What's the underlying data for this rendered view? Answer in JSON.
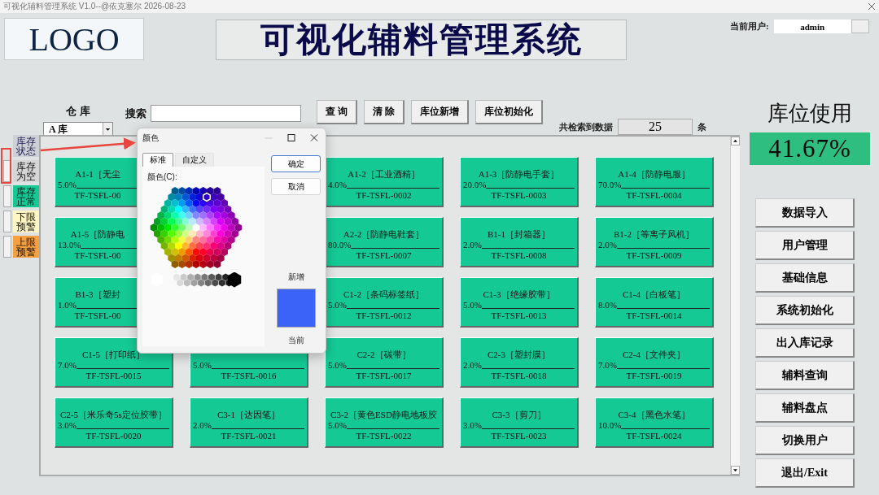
{
  "window": {
    "title": "可视化辅料管理系统 V1.0--@依克塞尔  2026-08-23"
  },
  "logo": "LOGO",
  "app_title": "可视化辅料管理系统",
  "user": {
    "label": "当前用户:",
    "value": "admin"
  },
  "warehouse": {
    "label": "仓 库",
    "value": "A 库"
  },
  "search": {
    "label": "搜索"
  },
  "actions": [
    "查 询",
    "清 除",
    "库位新增",
    "库位初始化"
  ],
  "result": {
    "label": "共检索到数据",
    "count": "25",
    "unit": "条"
  },
  "usage": {
    "label": "库位使用",
    "value": "41.67%"
  },
  "legend": [
    {
      "kind": "header",
      "label": "库存状态"
    },
    {
      "kind": "swatch",
      "label": "库存为空",
      "color": "#d6d6d6"
    },
    {
      "kind": "swatch",
      "label": "库存正常",
      "color": "#14c994"
    },
    {
      "kind": "swatch",
      "label": "下限预警",
      "color": "#fff6c2"
    },
    {
      "kind": "swatch",
      "label": "上限预警",
      "color": "#f7a040"
    }
  ],
  "tiles": [
    {
      "kind": "partial",
      "label": "A1-1［无尘",
      "percent": "5.0%",
      "code": "TF-TSFL-00"
    },
    {
      "kind": "covered"
    },
    {
      "kind": "full",
      "label": "A1-2［工业酒精］",
      "percent": "4.0%",
      "code": "TF-TSFL-0002"
    },
    {
      "kind": "full",
      "label": "A1-3［防静电手套］",
      "percent": "20.0%",
      "code": "TF-TSFL-0003"
    },
    {
      "kind": "full",
      "label": "A1-4［防静电服］",
      "percent": "70.0%",
      "code": "TF-TSFL-0004"
    },
    {
      "kind": "partial",
      "label": "A1-5［防静电",
      "percent": "13.0%",
      "code": "TF-TSFL-00"
    },
    {
      "kind": "covered"
    },
    {
      "kind": "full",
      "label": "A2-2［防静电鞋套］",
      "percent": "80.0%",
      "code": "TF-TSFL-0007"
    },
    {
      "kind": "full",
      "label": "B1-1［封箱器］",
      "percent": "2.0%",
      "code": "TF-TSFL-0008"
    },
    {
      "kind": "full",
      "label": "B1-2［等离子风机］",
      "percent": "2.0%",
      "code": "TF-TSFL-0009"
    },
    {
      "kind": "partial",
      "label": "B1-3［塑封",
      "percent": "1.0%",
      "code": "TF-TSFL-00"
    },
    {
      "kind": "covered"
    },
    {
      "kind": "full",
      "label": "C1-2［条码标签纸］",
      "percent": "5.0%",
      "code": "TF-TSFL-0012"
    },
    {
      "kind": "full",
      "label": "C1-3［绝缘胶带］",
      "percent": "5.0%",
      "code": "TF-TSFL-0013"
    },
    {
      "kind": "full",
      "label": "C1-4［白板笔］",
      "percent": "8.0%",
      "code": "TF-TSFL-0014"
    },
    {
      "kind": "full",
      "label": "C1-5［打印纸］",
      "percent": "7.0%",
      "code": "TF-TSFL-0015"
    },
    {
      "kind": "full",
      "percent": "5.0%",
      "code": "TF-TSFL-0016"
    },
    {
      "kind": "full",
      "label": "C2-2［碳带］",
      "percent": "5.0%",
      "code": "TF-TSFL-0017"
    },
    {
      "kind": "full",
      "label": "C2-3［塑封膜］",
      "percent": "2.0%",
      "code": "TF-TSFL-0018"
    },
    {
      "kind": "full",
      "label": "C2-4［文件夹］",
      "percent": "7.0%",
      "code": "TF-TSFL-0019"
    },
    {
      "kind": "full",
      "label": "C2-5［米乐奇5s定位胶带］",
      "percent": "3.0%",
      "code": "TF-TSFL-0020"
    },
    {
      "kind": "full",
      "label": "C3-1［达因笔］",
      "percent": "2.0%",
      "code": "TF-TSFL-0021"
    },
    {
      "kind": "full",
      "label": "C3-2［黄色ESD静电地板胶",
      "percent": "5.0%",
      "code": "TF-TSFL-0022"
    },
    {
      "kind": "full",
      "label": "C3-3［剪刀］",
      "percent": "3.0%",
      "code": "TF-TSFL-0023"
    },
    {
      "kind": "full",
      "label": "C3-4［黑色水笔］",
      "percent": "10.0%",
      "code": "TF-TSFL-0024"
    }
  ],
  "menu": [
    "数据导入",
    "用户管理",
    "基础信息",
    "系统初始化",
    "出入库记录",
    "辅料查询",
    "辅料盘点",
    "切换用户",
    "退出/Exit"
  ],
  "dialog": {
    "title": "颜色",
    "tabs": [
      {
        "label": "标准",
        "selected": true
      },
      {
        "label": "自定义",
        "selected": false
      }
    ],
    "palette_label": "颜色(C):",
    "buttons": [
      {
        "label": "确定",
        "default": true
      },
      {
        "label": "取消",
        "default": false
      }
    ],
    "preview": {
      "label": "新增",
      "color": "#3b63f7"
    },
    "current_label": "当前"
  }
}
